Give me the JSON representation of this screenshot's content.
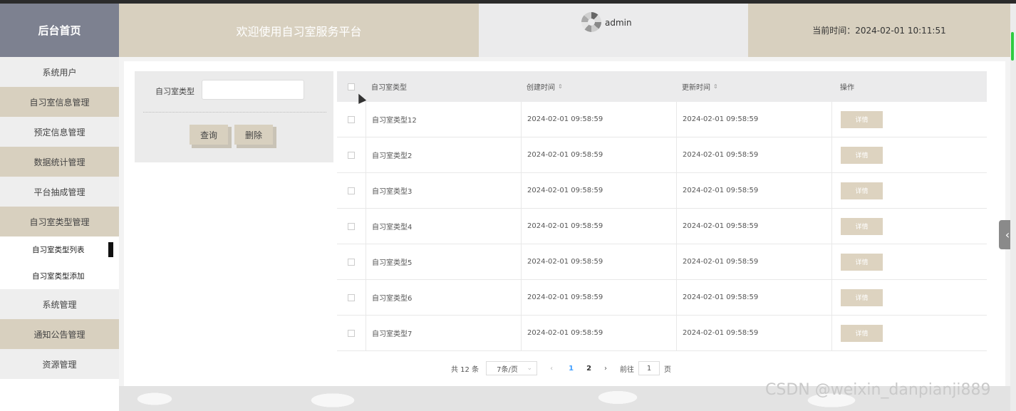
{
  "header": {
    "logo_title": "后台首页",
    "welcome_text": "欢迎使用自习室服务平台",
    "username": "admin",
    "current_time": "当前时间：2024-02-01 10:11:51"
  },
  "sidebar": {
    "items": [
      {
        "label": "系统用户"
      },
      {
        "label": "自习室信息管理"
      },
      {
        "label": "预定信息管理"
      },
      {
        "label": "数据统计管理"
      },
      {
        "label": "平台抽成管理"
      },
      {
        "label": "自习室类型管理"
      },
      {
        "label": "自习室类型列表"
      },
      {
        "label": "自习室类型添加"
      },
      {
        "label": "系统管理"
      },
      {
        "label": "通知公告管理"
      },
      {
        "label": "资源管理"
      }
    ]
  },
  "search": {
    "label": "自习室类型",
    "placeholder": "",
    "query_button": "查询",
    "delete_button": "删除"
  },
  "table": {
    "headers": [
      "自习室类型",
      "创建时间",
      "更新时间",
      "操作"
    ],
    "sort_icon": "⇕",
    "detail_label": "详情",
    "rows": [
      {
        "type": "自习室类型12",
        "created": "2024-02-01 09:58:59",
        "updated": "2024-02-01 09:58:59"
      },
      {
        "type": "自习室类型2",
        "created": "2024-02-01 09:58:59",
        "updated": "2024-02-01 09:58:59"
      },
      {
        "type": "自习室类型3",
        "created": "2024-02-01 09:58:59",
        "updated": "2024-02-01 09:58:59"
      },
      {
        "type": "自习室类型4",
        "created": "2024-02-01 09:58:59",
        "updated": "2024-02-01 09:58:59"
      },
      {
        "type": "自习室类型5",
        "created": "2024-02-01 09:58:59",
        "updated": "2024-02-01 09:58:59"
      },
      {
        "type": "自习室类型6",
        "created": "2024-02-01 09:58:59",
        "updated": "2024-02-01 09:58:59"
      },
      {
        "type": "自习室类型7",
        "created": "2024-02-01 09:58:59",
        "updated": "2024-02-01 09:58:59"
      }
    ]
  },
  "pagination": {
    "total": "共 12 条",
    "page_size": "7条/页",
    "prev": "‹",
    "pages": [
      "1",
      "2"
    ],
    "next": "›",
    "goto_prefix": "前往",
    "goto_value": "1",
    "goto_suffix": "页"
  },
  "watermark": "CSDN @weixin_danpianji889",
  "colors": {
    "accent": "#d8d0bf",
    "logo_bg": "#7d8190",
    "active_page": "#409eff"
  }
}
